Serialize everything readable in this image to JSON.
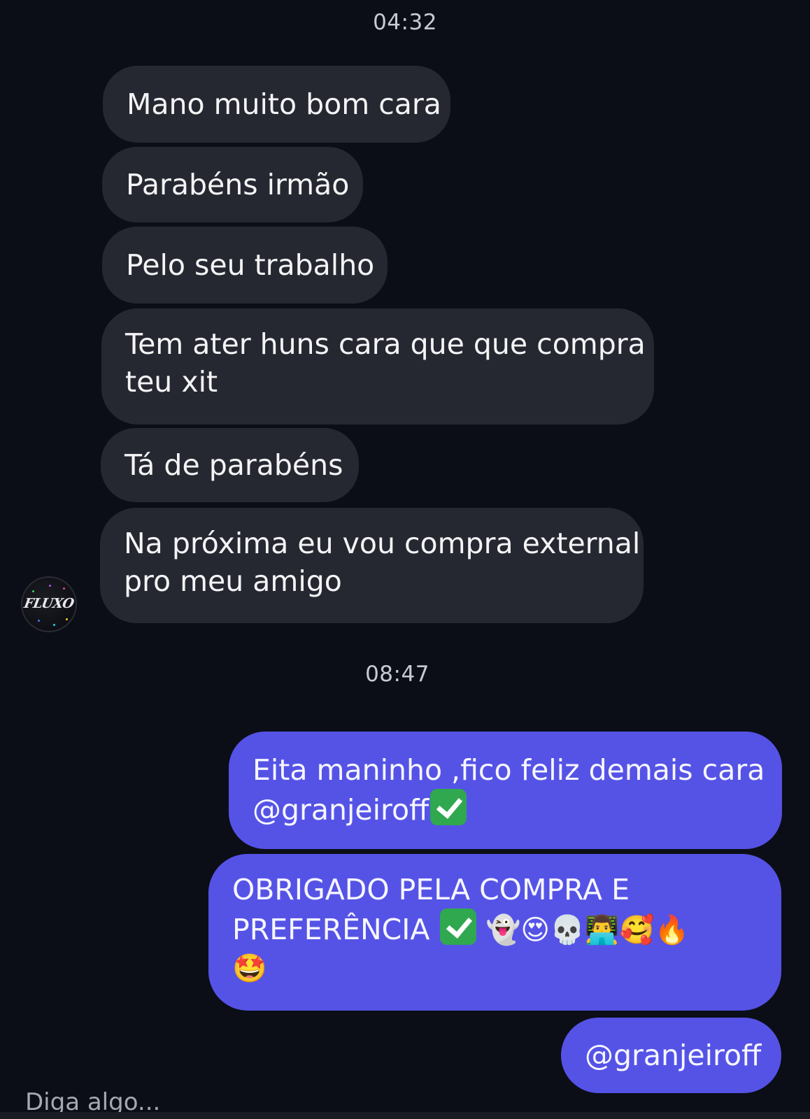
{
  "timestamps": {
    "first": "04:32",
    "second": "08:47"
  },
  "incoming_messages": [
    {
      "text": "Mano muito bom cara"
    },
    {
      "text": "Parabéns irmão"
    },
    {
      "text": "Pelo seu trabalho"
    },
    {
      "line1": "Tem ater huns cara que que compra",
      "line2": "teu xit"
    },
    {
      "text": "Tá de parabéns"
    },
    {
      "line1": "Na próxima eu vou compra external",
      "line2": "pro meu amigo"
    }
  ],
  "avatar": {
    "label": "FLUXO",
    "icon": "fluxo-logo-avatar"
  },
  "outgoing_messages": [
    {
      "line1": "Eita maninho ,fico feliz demais cara",
      "line2": "@granjeiroff",
      "line2_emoji": "check-mark-button-emoji"
    },
    {
      "line1": "OBRIGADO PELA COMPRA E",
      "line2": "PREFERÊNCIA",
      "line2_emojis": [
        "👻",
        "😍",
        "💀",
        "👨‍💻",
        "🥰",
        "🔥"
      ],
      "line3_emoji": "🤩"
    },
    {
      "text": "@granjeiroff"
    }
  ],
  "composer": {
    "placeholder": "Diga algo..."
  },
  "colors": {
    "background": "#0c0e17",
    "incoming_bubble": "#262831",
    "outgoing_bubble": "#5553e6"
  }
}
